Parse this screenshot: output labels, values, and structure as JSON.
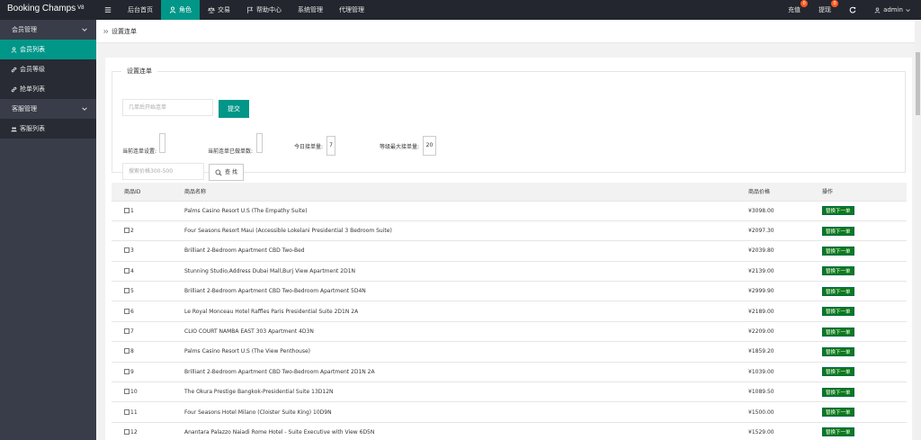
{
  "app": {
    "brand": "Booking Champs",
    "version": "V8"
  },
  "topnav": [
    {
      "label": "",
      "icon": "menu-icon"
    },
    {
      "label": "后台首页",
      "icon": ""
    },
    {
      "label": "角色",
      "icon": "user-icon",
      "active": true
    },
    {
      "label": "交易",
      "icon": "scale-icon"
    },
    {
      "label": "帮助中心",
      "icon": "flag-icon"
    },
    {
      "label": "系统管理",
      "icon": ""
    },
    {
      "label": "代理管理",
      "icon": ""
    }
  ],
  "topright": {
    "recharge": {
      "label": "充值",
      "badge": "0"
    },
    "withdraw": {
      "label": "提现",
      "badge": "0"
    },
    "refresh_icon": "refresh-icon",
    "user": "admin"
  },
  "sidebar": {
    "groups": [
      {
        "label": "会员管理",
        "items": [
          {
            "label": "会员列表",
            "icon": "user-icon",
            "active": true
          },
          {
            "label": "会员等级",
            "icon": "link-icon"
          },
          {
            "label": "抢单列表",
            "icon": "link-icon"
          }
        ]
      },
      {
        "label": "客服管理",
        "items": [
          {
            "label": "客服列表",
            "icon": "users-icon"
          }
        ]
      }
    ]
  },
  "breadcrumb": "设置连单",
  "settings": {
    "legend": "设置连单",
    "after_orders_placeholder": "几单后开始连单",
    "submit_label": "提交",
    "current_setting_label": "当前连单设置:",
    "current_done_label": "当前连单已做单数:",
    "today_count_label": "今日接单量:",
    "today_count_value": "7",
    "level_max_label": "等级最大接单量:",
    "level_max_value": "20",
    "price_placeholder": "搜索价格300-500",
    "search_label": "查 找"
  },
  "table": {
    "headers": [
      "商品ID",
      "商品名称",
      "商品价格",
      "操作"
    ],
    "action_label": "替换下一单",
    "rows": [
      {
        "id": "1",
        "name": "Palms Casino Resort U.S (The Empathy Suite)",
        "price": "¥3098.00"
      },
      {
        "id": "2",
        "name": "Four Seasons Resort Maui (Accessible Lokelani Presidential 3 Bedroom Suite)",
        "price": "¥2097.30"
      },
      {
        "id": "3",
        "name": "Brilliant 2-Bedroom Apartment CBD Two-Bed",
        "price": "¥2039.80"
      },
      {
        "id": "4",
        "name": "Stunning Studio,Address Dubai Mall,Burj View Apartment 2D1N",
        "price": "¥2139.00"
      },
      {
        "id": "5",
        "name": "Brilliant 2-Bedroom Apartment CBD Two-Bedroom Apartment 5D4N",
        "price": "¥2999.90"
      },
      {
        "id": "6",
        "name": "Le Royal Monceau Hotel Raffles Paris Presidential Suite 2D1N 2A",
        "price": "¥2189.00"
      },
      {
        "id": "7",
        "name": "CLIO COURT NAMBA EAST 303 Apartment 4D3N",
        "price": "¥2209.00"
      },
      {
        "id": "8",
        "name": "Palms Casino Resort U.S (The View Penthouse)",
        "price": "¥1859.20"
      },
      {
        "id": "9",
        "name": "Brilliant 2-Bedroom Apartment CBD Two-Bedroom Apartment 2D1N 2A",
        "price": "¥1039.00"
      },
      {
        "id": "10",
        "name": "The Okura Prestige Bangkok-Presidential Suite 13D12N",
        "price": "¥1089.50"
      },
      {
        "id": "11",
        "name": "Four Seasons Hotel Milano (Cloister Suite King) 10D9N",
        "price": "¥1500.00"
      },
      {
        "id": "12",
        "name": "Anantara Palazzo Naiadi Rome Hotel - Suite Executive with View 6D5N",
        "price": "¥1529.00"
      }
    ]
  }
}
